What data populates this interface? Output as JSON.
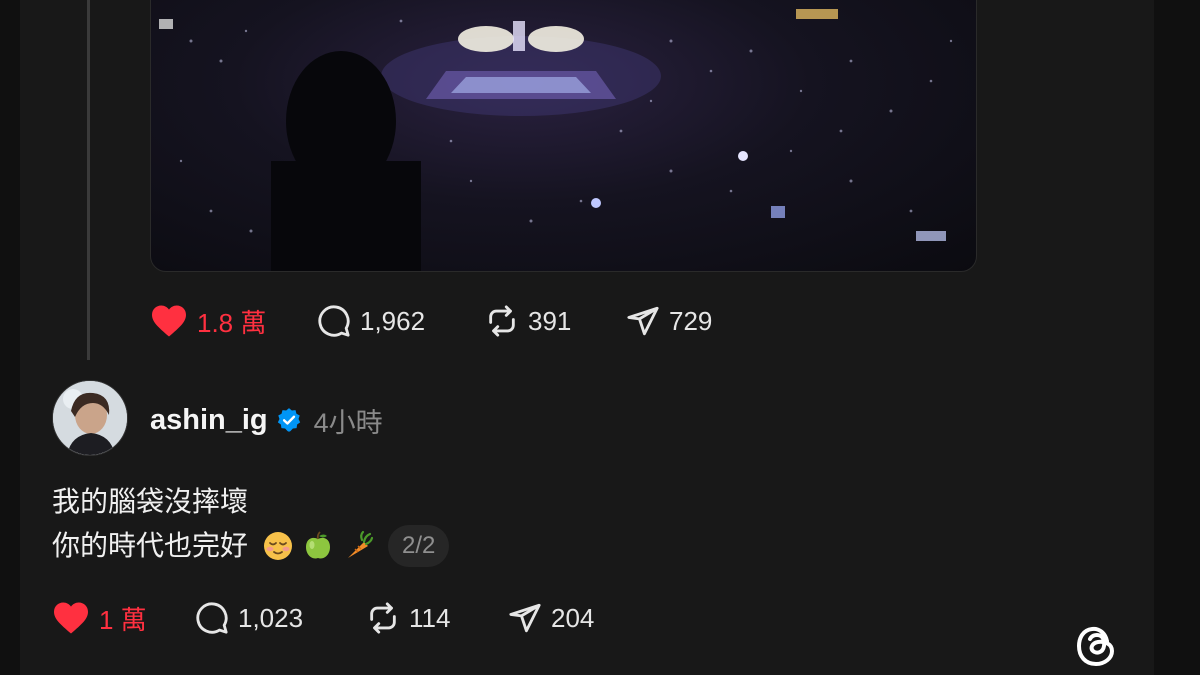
{
  "post1": {
    "media": {
      "description_icon": "concert-video"
    },
    "actions": {
      "likes": "1.8 萬",
      "replies": "1,962",
      "reposts": "391",
      "shares": "729"
    }
  },
  "post2": {
    "username": "ashin_ig",
    "time": "4小時",
    "text_line1": "我的腦袋沒摔壞",
    "text_line2": "你的時代也完好",
    "page_indicator": "2/2",
    "actions": {
      "likes": "1 萬",
      "replies": "1,023",
      "reposts": "114",
      "shares": "204"
    }
  },
  "colors": {
    "background": "#181818",
    "like": "#ff3040",
    "verified": "#0095f6",
    "muted": "#8a8a8a"
  },
  "icons": [
    "heart-icon",
    "comment-icon",
    "repost-icon",
    "share-icon",
    "verified-badge-icon",
    "threads-logo-icon"
  ]
}
